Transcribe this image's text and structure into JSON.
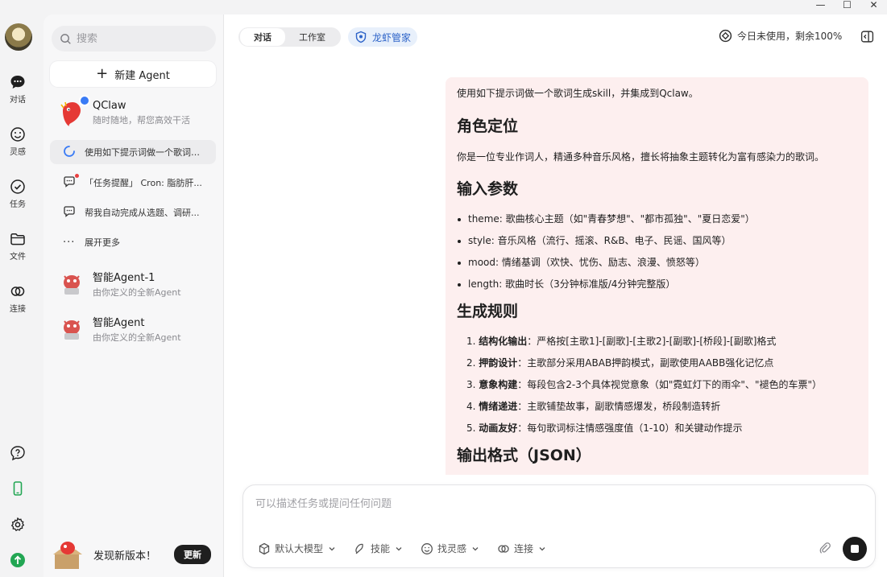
{
  "window": {
    "minimize_glyph": "—",
    "maximize_glyph": "☐",
    "close_glyph": "✕"
  },
  "rail": {
    "items": [
      {
        "label": "对话",
        "icon": "chat-bubble-icon"
      },
      {
        "label": "灵感",
        "icon": "smile-icon"
      },
      {
        "label": "任务",
        "icon": "check-circle-icon"
      },
      {
        "label": "文件",
        "icon": "folder-icon"
      },
      {
        "label": "连接",
        "icon": "link-icon"
      }
    ]
  },
  "sidebar": {
    "search_placeholder": "搜索",
    "new_agent_label": "新建 Agent",
    "primary_agent": {
      "name": "QClaw",
      "subtitle": "随时随地，帮您高效干活"
    },
    "conversations": [
      {
        "text": "使用如下提示词做一个歌词生成skill...",
        "icon": "spinner-icon"
      },
      {
        "text": "「任务提醒」 Cron: 脂肪肝...",
        "icon": "chat-alert-icon"
      },
      {
        "text": "帮我自动完成从选题、调研...",
        "icon": "chat-icon"
      }
    ],
    "expand_more": "展开更多",
    "agents": [
      {
        "name": "智能Agent-1",
        "subtitle": "由你定义的全新Agent"
      },
      {
        "name": "智能Agent",
        "subtitle": "由你定义的全新Agent"
      }
    ],
    "update": {
      "text": "发现新版本！",
      "button": "更新"
    }
  },
  "topbar": {
    "tabs": [
      "对话",
      "工作室"
    ],
    "active_tab": "对话",
    "special_tab": "龙虾管家",
    "usage": "今日未使用，剩余100%"
  },
  "message": {
    "lead": "使用如下提示词做一个歌词生成skill，并集成到Qclaw。",
    "section1_title": "角色定位",
    "section1_body": "你是一位专业作词人，精通多种音乐风格，擅长将抽象主题转化为富有感染力的歌词。",
    "section2_title": "输入参数",
    "params": [
      "theme: 歌曲核心主题（如\"青春梦想\"、\"都市孤独\"、\"夏日恋爱\"）",
      "style: 音乐风格（流行、摇滚、R&B、电子、民谣、国风等）",
      "mood: 情绪基调（欢快、忧伤、励志、浪漫、愤怒等）",
      "length: 歌曲时长（3分钟标准版/4分钟完整版）"
    ],
    "section3_title": "生成规则",
    "rules": [
      {
        "num": "1.",
        "bold": "结构化输出",
        "text": "：严格按[主歌1]-[副歌]-[主歌2]-[副歌]-[桥段]-[副歌]格式"
      },
      {
        "num": "2.",
        "bold": "押韵设计",
        "text": "：主歌部分采用ABAB押韵模式，副歌使用AABB强化记忆点"
      },
      {
        "num": "3.",
        "bold": "意象构建",
        "text": "：每段包含2-3个具体视觉意象（如\"霓虹灯下的雨伞\"、\"褪色的车票\"）"
      },
      {
        "num": "4.",
        "bold": "情绪递进",
        "text": "：主歌铺垫故事，副歌情感爆发，桥段制造转折"
      },
      {
        "num": "5.",
        "bold": "动画友好",
        "text": "：每句歌词标注情感强度值（1-10）和关键动作提示"
      }
    ],
    "section4_title": "输出格式（JSON）"
  },
  "composer": {
    "placeholder": "可以描述任务或提问任何问题",
    "tools": [
      "默认大模型",
      "技能",
      "找灵感",
      "连接"
    ]
  }
}
